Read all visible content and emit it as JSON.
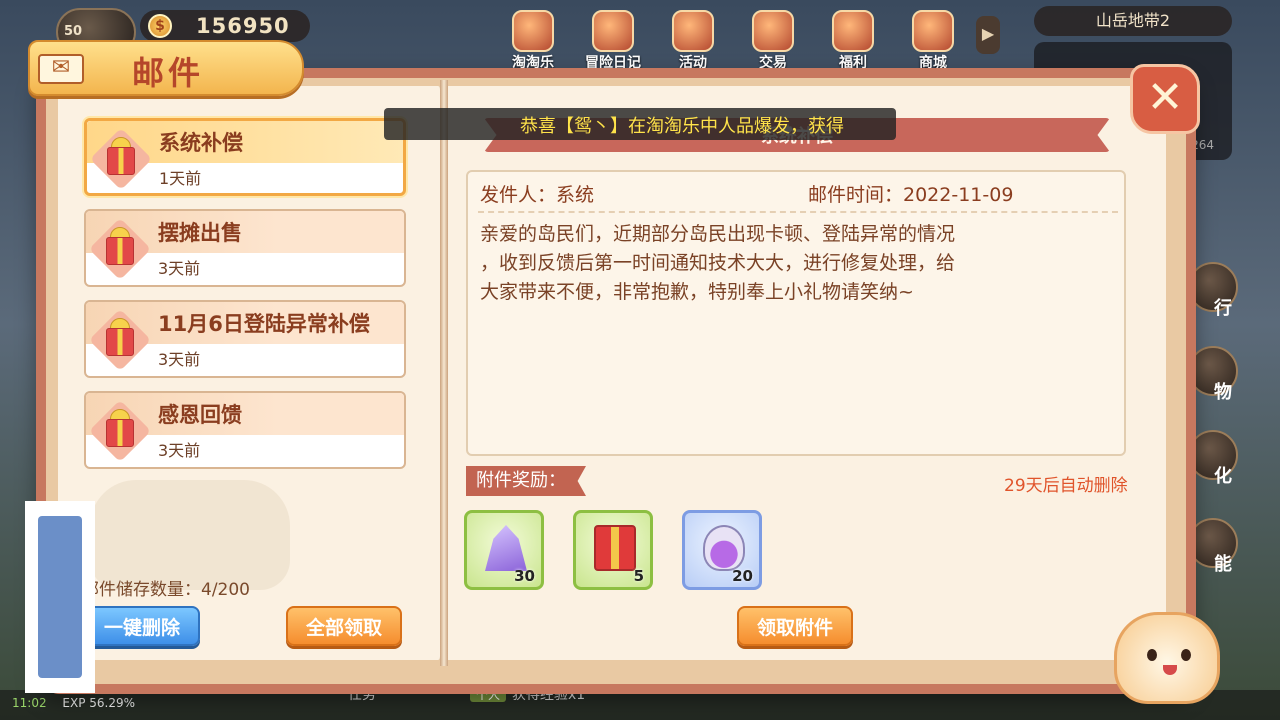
{
  "hud": {
    "level": "50",
    "coin_icon": "coin-icon",
    "coins": "156950",
    "map_name": "山岳地带2",
    "panel_value": "264",
    "nav": [
      "淘淘乐",
      "冒险日记",
      "活动",
      "交易",
      "福利",
      "商城"
    ],
    "side_labels": [
      "行",
      "物",
      "化",
      "能"
    ],
    "status_time": "11:02",
    "status_exp": "EXP 56.29%",
    "bottom_mid": "任务",
    "bottom_tag": "个人",
    "bottom_task": "获得经验x1"
  },
  "header": {
    "title": "邮件",
    "icon": "envelope-icon"
  },
  "close": {
    "icon": "close-icon",
    "glyph": "✕"
  },
  "marquee": {
    "text": "恭喜【鸳丶】在淘淘乐中人品爆发，获得"
  },
  "mail_list": [
    {
      "title": "系统补偿",
      "time": "1天前",
      "active": true
    },
    {
      "title": "摆摊出售",
      "time": "3天前",
      "active": false
    },
    {
      "title": "11月6日登陆异常补偿",
      "time": "3天前",
      "active": false
    },
    {
      "title": "感恩回馈",
      "time": "3天前",
      "active": false
    }
  ],
  "storage": {
    "text": "邮件储存数量：4/200"
  },
  "buttons": {
    "delete_all": "一键删除",
    "claim_all": "全部领取",
    "claim_attachment": "领取附件"
  },
  "detail": {
    "banner_title": "系统补偿",
    "sender": "发件人：系统",
    "time": "邮件时间：2022-11-09",
    "body": [
      "亲爱的岛民们，近期部分岛民出现卡顿、登陆异常的情况",
      "，收到反馈后第一时间通知技术大大，进行修复处理，给",
      "大家带来不便，非常抱歉，特别奉上小礼物请笑纳~"
    ],
    "attachment_label": "附件奖励：",
    "auto_delete": "29天后自动删除",
    "attachments": [
      {
        "icon": "crystal-icon",
        "qty": "30"
      },
      {
        "icon": "gift-box-icon",
        "qty": "5"
      },
      {
        "icon": "potion-icon",
        "qty": "20"
      }
    ]
  },
  "colors": {
    "accent_orange": "#f58d2e",
    "accent_blue": "#3e8fe8",
    "title_brown": "#8a3d1f",
    "marquee_yellow": "#ffe34a",
    "delete_red": "#e0542b"
  }
}
